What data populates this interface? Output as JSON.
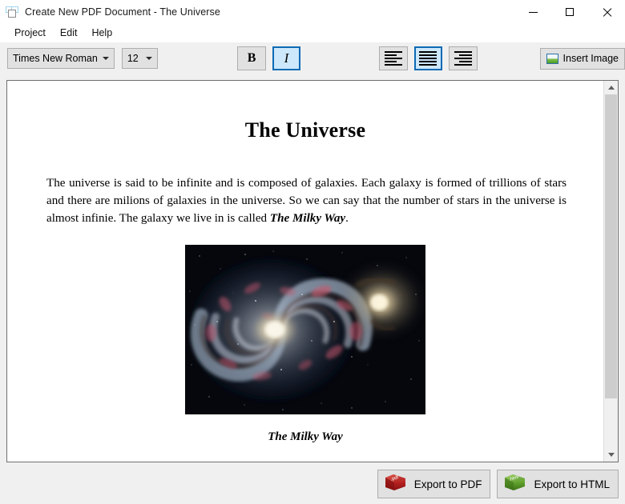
{
  "window": {
    "title": "Create New PDF Document - The Universe",
    "app_icon": "overlapping-squares-icon",
    "controls": {
      "minimize": "minimize-icon",
      "maximize": "maximize-icon",
      "close": "close-icon"
    }
  },
  "menubar": {
    "items": [
      {
        "label": "Project"
      },
      {
        "label": "Edit"
      },
      {
        "label": "Help"
      }
    ]
  },
  "toolbar": {
    "font_family": {
      "value": "Times New Roman",
      "icon": "chevron-down-icon"
    },
    "font_size": {
      "value": "12",
      "icon": "chevron-down-icon"
    },
    "bold": {
      "label": "B",
      "active": false,
      "icon": "bold-icon"
    },
    "italic": {
      "label": "I",
      "active": true,
      "icon": "italic-icon"
    },
    "align_left": {
      "active": false,
      "icon": "align-left-icon"
    },
    "align_center": {
      "active": true,
      "icon": "align-center-icon"
    },
    "align_right": {
      "active": false,
      "icon": "align-right-icon"
    },
    "insert_image": {
      "label": "Insert Image",
      "icon": "picture-icon"
    }
  },
  "document": {
    "title": "The Universe",
    "paragraph_part1": "The universe is said to be infinite and is composed of galaxies. Each galaxy is formed of trillions of stars and there are milions of galaxies in the universe. So we can say that the number of stars in the universe is almost infinie. The galaxy we live in is called ",
    "paragraph_emphasis": "The Milky Way",
    "paragraph_part2": ".",
    "image_alt": "spiral-galaxy-photo",
    "figure_caption": "The Milky Way"
  },
  "scrollbar": {
    "up_icon": "chevron-up-icon",
    "down_icon": "chevron-down-icon"
  },
  "footer": {
    "export_pdf": {
      "label": "Export to PDF",
      "icon": "pdf-file-icon",
      "icon_text": ".pdf",
      "color": "#b01f1f"
    },
    "export_html": {
      "label": "Export to HTML",
      "icon": "html-file-icon",
      "icon_text": ".html",
      "color": "#5d9e2a"
    }
  },
  "colors": {
    "accent": "#0d6ab4",
    "toolbar_bg": "#f0f0f0",
    "button_bg": "#e1e1e1",
    "active_bg": "#cde8fa"
  }
}
